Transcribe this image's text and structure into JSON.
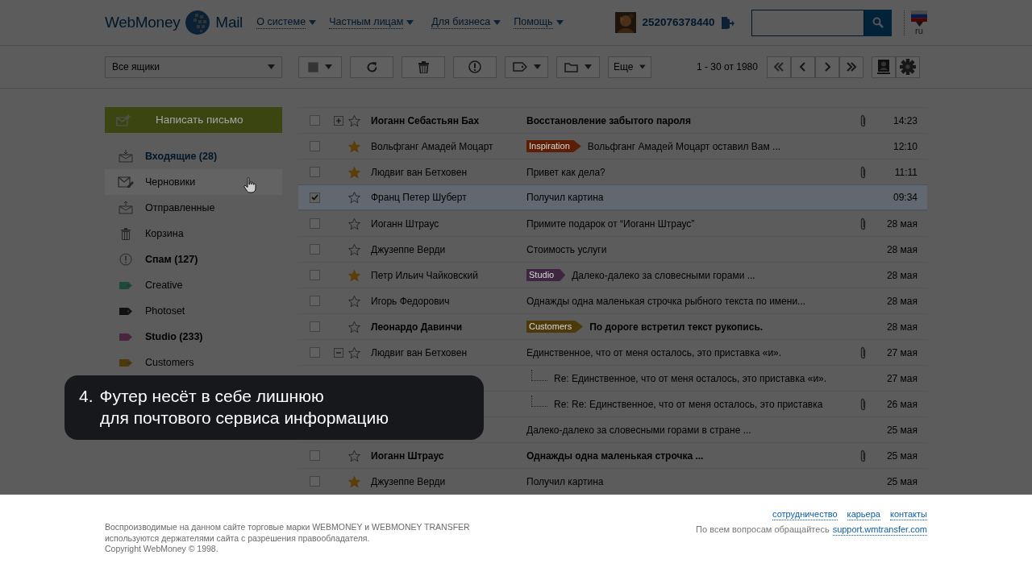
{
  "header": {
    "logo": {
      "name": "WebMoney",
      "product": "Mail"
    },
    "nav": [
      {
        "label": "О системе"
      },
      {
        "label": "Частным лицам"
      },
      {
        "label": "Для бизнеса"
      },
      {
        "label": "Помощь"
      }
    ],
    "account": "252076378440",
    "language": "ru"
  },
  "toolbar": {
    "mailbox_select": "Все ящики",
    "more_button": "Еще",
    "pagination": "1 - 30 от 1980"
  },
  "sidebar": {
    "compose_button": "Написать письмо",
    "folders": [
      {
        "kind": "inbox",
        "label": "Входящие (28)",
        "selected": true,
        "unread": true,
        "hovered": false
      },
      {
        "kind": "drafts",
        "label": "Черновики",
        "selected": false,
        "unread": false,
        "hovered": true
      },
      {
        "kind": "sent",
        "label": "Отправленные",
        "selected": false,
        "unread": false,
        "hovered": false
      },
      {
        "kind": "trash",
        "label": "Корзина",
        "selected": false,
        "unread": false,
        "hovered": false
      },
      {
        "kind": "spam",
        "label": "Спам (127)",
        "selected": false,
        "unread": true,
        "hovered": false
      },
      {
        "kind": "label",
        "label": "Creative",
        "color": "#1d4a3c",
        "selected": false,
        "unread": false,
        "hovered": false
      },
      {
        "kind": "label",
        "label": "Photoset",
        "color": "#111111",
        "selected": false,
        "unread": false,
        "hovered": false
      },
      {
        "kind": "label",
        "label": "Studio (233)",
        "color": "#4a2540",
        "selected": false,
        "unread": true,
        "hovered": false
      },
      {
        "kind": "label",
        "label": "Customers",
        "color": "#4d3a0a",
        "selected": false,
        "unread": false,
        "hovered": false
      }
    ]
  },
  "messages": [
    {
      "checked": false,
      "expanded": false,
      "starred": false,
      "unread": true,
      "sender": "Иоганн Себастьян Бах",
      "subject": "Восстановление забытого пароля",
      "attachment": true,
      "time": "14:23"
    },
    {
      "checked": false,
      "starred": true,
      "unread": false,
      "sender": "Вольфганг Амадей Моцарт",
      "tag": {
        "label": "Inspiration",
        "color": "#5c1f05"
      },
      "subject": "Вольфганг Амадей Моцарт оставил Вам ...",
      "attachment": false,
      "time": "12:10"
    },
    {
      "checked": false,
      "starred": true,
      "unread": false,
      "sender": "Людвиг ван Бетховен",
      "subject": "Привет как дела?",
      "attachment": true,
      "time": "11:11"
    },
    {
      "checked": true,
      "starred": false,
      "unread": false,
      "sender": "Франц Петер Шуберт",
      "subject": "Получил картина",
      "attachment": false,
      "time": "09:34"
    },
    {
      "checked": false,
      "starred": false,
      "unread": false,
      "sender": "Иоганн Штраус",
      "subject": "Примите подарок от “Иоганн Штраус”",
      "attachment": true,
      "time": "28 мая"
    },
    {
      "checked": false,
      "starred": false,
      "unread": false,
      "sender": "Джузеппе Верди",
      "subject": "Стоимость услуги",
      "attachment": false,
      "time": "28 мая"
    },
    {
      "checked": false,
      "starred": true,
      "unread": false,
      "sender": "Петр Ильич Чайковский",
      "tag": {
        "label": "Studio",
        "color": "#3f2640"
      },
      "subject": "Далеко-далеко за словесными горами ...",
      "attachment": false,
      "time": "28 мая"
    },
    {
      "checked": false,
      "starred": false,
      "unread": false,
      "sender": "Игорь Федорович",
      "subject": "Однажды одна маленькая строчка рыбного текста по имени...",
      "attachment": false,
      "time": "28 мая"
    },
    {
      "checked": false,
      "starred": false,
      "unread": true,
      "sender": "Леонардо Давинчи",
      "tag": {
        "label": "Customers",
        "color": "#4d3a0a"
      },
      "subject": "По дороге встретил текст рукопись.",
      "attachment": false,
      "time": "28 мая"
    },
    {
      "checked": false,
      "expanded": true,
      "starred": false,
      "unread": false,
      "sender": "Людвиг ван Бетховен",
      "subject": "Единственное, что от меня осталось, это приставка «и».",
      "attachment": true,
      "time": "27 мая",
      "children": [
        {
          "subject": "Re: Единственное, что от меня осталось, это приставка «и».",
          "attachment": false,
          "time": "27 мая"
        },
        {
          "subject": "Re: Re: Единственное, что от меня осталось, это приставка",
          "attachment": true,
          "time": "26 мая"
        }
      ]
    },
    {
      "unread": false,
      "subject": "Далеко-далеко за словесными горами в стране ...",
      "attachment": false,
      "time": "25 мая"
    },
    {
      "checked": false,
      "starred": false,
      "unread": true,
      "sender": "Иоганн Штраус",
      "subject": "Однажды одна маленькая строчка ...",
      "attachment": true,
      "time": "25 мая"
    },
    {
      "checked": false,
      "starred": true,
      "unread": false,
      "sender": "Джузеппе Верди",
      "subject": "Получил картина",
      "attachment": false,
      "time": "25 мая"
    }
  ],
  "callout": {
    "number": "4.",
    "lines": [
      "Футер несёт в себе лишнюю",
      "для почтового сервиса информацию"
    ]
  },
  "footer": {
    "notice": [
      "Воспроизводимые на данном сайте торговые марки WEBMONEY и WEBMONEY TRANSFER",
      "используются держателями сайта с разрешения правообладателя.",
      "Copyright WebMoney © 1998."
    ],
    "links": [
      {
        "label": "сотрудничество"
      },
      {
        "label": "карьера"
      },
      {
        "label": "контакты"
      }
    ],
    "support": {
      "text": "По всем вопросам обращайтесь",
      "link": "support.wmtransfer.com"
    }
  }
}
